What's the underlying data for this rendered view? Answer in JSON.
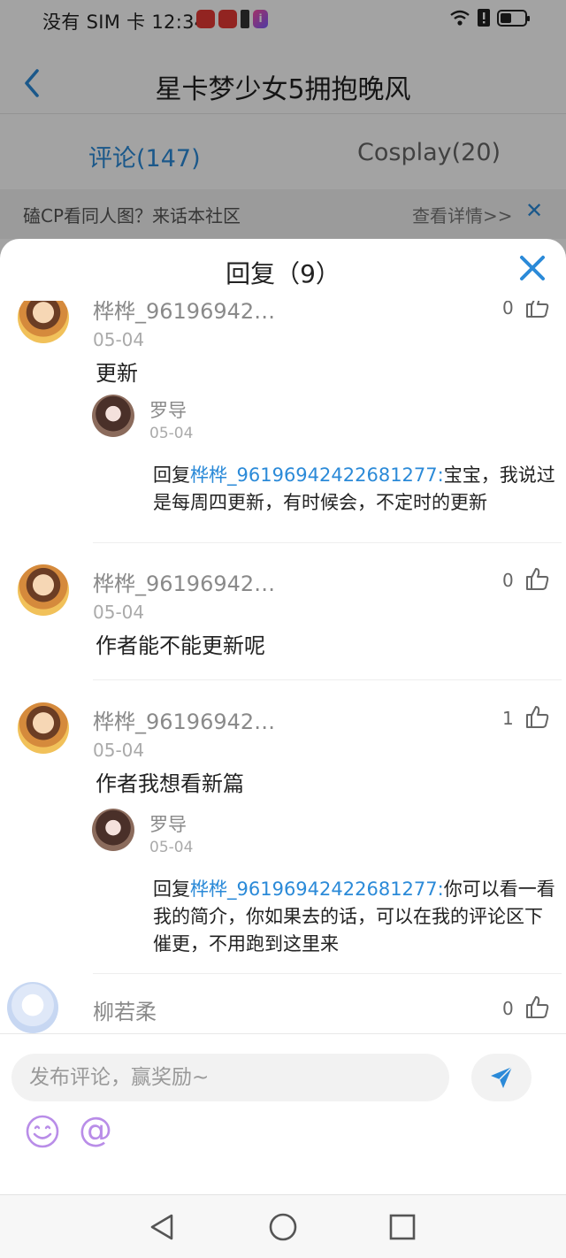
{
  "status_bar": {
    "text": "没有 SIM 卡 12:34",
    "battery_level": 0.45
  },
  "header": {
    "title": "星卡梦少女5拥抱晚风",
    "tabs": [
      {
        "label": "评论(147)",
        "active": true
      },
      {
        "label": "Cosplay(20)",
        "active": false
      }
    ]
  },
  "promo": {
    "text": "磕CP看同人图？来话本社区",
    "link": "查看详情>>"
  },
  "sheet": {
    "title": "回复（9）",
    "comments": [
      {
        "username": "桦桦_96196942…",
        "date": "05-04",
        "text": "更新",
        "likes": "0",
        "reply": {
          "username": "罗导",
          "date": "05-04",
          "prefix": "回复",
          "target": "桦桦_96196942422681277:",
          "text": "宝宝，我说过是每周四更新，有时候会，不定时的更新"
        }
      },
      {
        "username": "桦桦_96196942…",
        "date": "05-04",
        "text": "作者能不能更新呢",
        "likes": "0"
      },
      {
        "username": "桦桦_96196942…",
        "date": "05-04",
        "text": "作者我想看新篇",
        "likes": "1",
        "reply": {
          "username": "罗导",
          "date": "05-04",
          "prefix": "回复",
          "target": "桦桦_96196942422681277:",
          "text": "你可以看一看我的简介，你如果去的话，可以在我的评论区下催更，不用跑到这里来"
        }
      },
      {
        "username": "柳若柔",
        "likes": "0"
      }
    ]
  },
  "composer": {
    "placeholder": "发布评论，赢奖励~",
    "at_symbol": "@"
  },
  "icons": {
    "back": "chevron-left-icon",
    "close": "close-icon",
    "like": "thumbs-up-icon",
    "send": "send-icon",
    "emoji": "smiley-icon"
  },
  "colors": {
    "accent": "#2b8ad8",
    "icon_purple": "#b98de8"
  }
}
